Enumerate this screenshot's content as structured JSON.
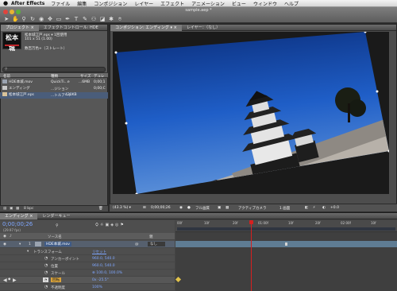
{
  "menubar": {
    "app_name": "After Effects",
    "items": [
      "ファイル",
      "編集",
      "コンポジション",
      "レイヤー",
      "エフェクト",
      "アニメーション",
      "ビュー",
      "ウィンドウ",
      "ヘルプ"
    ]
  },
  "window": {
    "title": "sample.aep *"
  },
  "project_panel": {
    "tabs": [
      "プロジェクト ×",
      "エフェクトコントロール: HDE"
    ],
    "thumb_text": "松本城",
    "info": [
      "松本城江戸.eps ▾ 1回使用",
      "101 x 51 (1.00)",
      "",
      "数百万色+（ストレート）"
    ],
    "columns": [
      "名前",
      "種類",
      "サイズ",
      "デュレ"
    ],
    "rows": [
      {
        "name": "HDE本城.mov",
        "type": "QuickTi...e",
        "size": "...6MB",
        "dur": "0;00;1",
        "icon_color": "#9aa3b0"
      },
      {
        "name": "エンディング",
        "type": "...ジション",
        "size": "",
        "dur": "0;00;C",
        "icon_color": "#c8c8c8"
      },
      {
        "name": "松本城江戸.eps",
        "type": "...トルアート",
        "size": "420KB",
        "dur": "",
        "icon_color": "#d8c39a"
      }
    ],
    "footer_text": "8 bpc"
  },
  "comp_panel": {
    "tabs": [
      "コンポジション: エンディング ▾ ×",
      "レイヤー：（なし）"
    ],
    "footer": {
      "zoom": "(43.3 %) ▾",
      "timecode": "0;00;00;26",
      "res": "フル画質",
      "camera": "アクティブカメラ",
      "view": "1 画面",
      "plus": "+0.0"
    }
  },
  "timeline": {
    "tabs": [
      "エンディング ×",
      "レンダーキュー"
    ],
    "timecode": "0;00;00;26",
    "fps": "(29.97 fps)",
    "col_source": "ソース名",
    "col_parent": "親",
    "parent_value": "なし",
    "ruler": [
      "00f",
      "10f",
      "20f",
      "01:00f",
      "10f",
      "20f",
      "02:00f",
      "10f"
    ],
    "layer": {
      "num": "1",
      "name": "HDE本城.mov"
    },
    "transform": "トランスフォーム",
    "reset": "リセット",
    "props": [
      {
        "label": "アンカーポイント",
        "value": "960.0, 540.0"
      },
      {
        "label": "位置",
        "value": "960.0, 540.0"
      },
      {
        "label": "スケール",
        "value": "⊕ 100.0, 100.0%"
      },
      {
        "label": "回転",
        "value": "0x -25.5°"
      },
      {
        "label": "不透明度",
        "value": "100%"
      }
    ]
  },
  "colors": {
    "accent_blue": "#7fa7ff",
    "playhead": "#d62020",
    "keyframe": "#e2c34a"
  }
}
